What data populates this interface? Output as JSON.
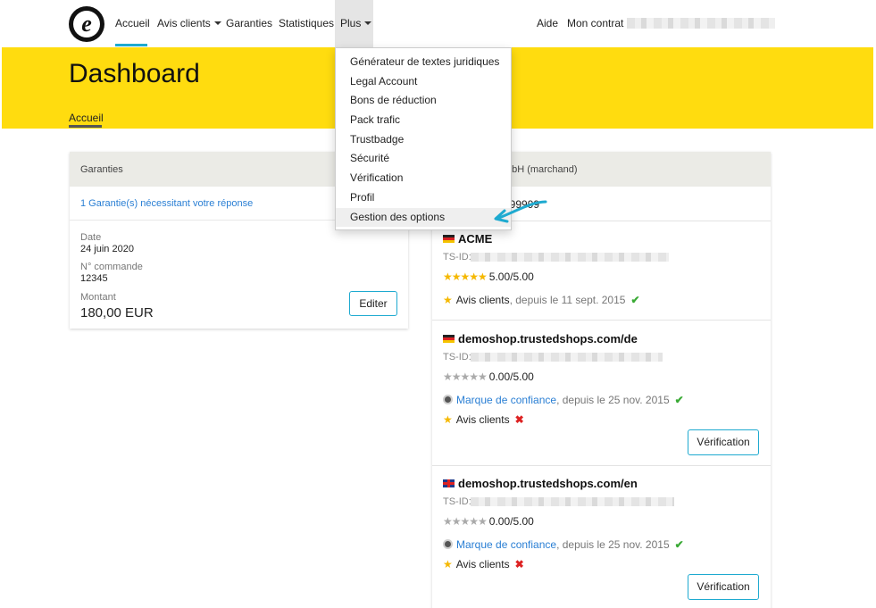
{
  "nav": {
    "logo_letter": "e",
    "items": [
      "Accueil",
      "Avis clients",
      "Garanties",
      "Statistiques",
      "Plus"
    ],
    "aide": "Aide",
    "mon_contrat": "Mon contrat"
  },
  "banner": {
    "title": "Dashboard",
    "breadcrumb": "Accueil"
  },
  "plus_menu": {
    "items": [
      "Générateur de textes juridiques",
      "Legal Account",
      "Bons de réduction",
      "Pack trafic",
      "Trustbadge",
      "Sécurité",
      "Vérification",
      "Profil",
      "Gestion des options"
    ],
    "highlighted_index": 8
  },
  "guarantees_card": {
    "header": "Garanties",
    "link": "1 Garantie(s) nécessitant votre réponse",
    "date_label": "Date",
    "date_value": "24 juin 2020",
    "order_label": "N° commande",
    "order_value": "12345",
    "amount_label": "Montant",
    "amount_value": "180,00 EUR",
    "edit_button": "Editer"
  },
  "merchant_card": {
    "header_partial": "nbH (marchand)",
    "id_partial": "999999",
    "shops": [
      {
        "flag": "de",
        "name": "ACME",
        "tsid_label": "TS-ID:",
        "rating": "5.00/5.00",
        "stars_filled": 5,
        "features": [
          {
            "icon": "star-icon",
            "label": "Avis clients",
            "suffix": ", depuis le 11 sept. 2015",
            "status": "active"
          }
        ]
      },
      {
        "flag": "de",
        "name": "demoshop.trustedshops.com/de",
        "tsid_label": "TS-ID:",
        "rating": "0.00/5.00",
        "stars_filled": 0,
        "features": [
          {
            "icon": "seal-icon",
            "label": "Marque de confiance",
            "suffix": ", depuis le 25 nov. 2015",
            "status": "active"
          },
          {
            "icon": "star-icon",
            "label": "Avis clients",
            "suffix": "",
            "status": "inactive"
          }
        ],
        "button": "Vérification"
      },
      {
        "flag": "uk",
        "name": "demoshop.trustedshops.com/en",
        "tsid_label": "TS-ID:",
        "rating": "0.00/5.00",
        "stars_filled": 0,
        "features": [
          {
            "icon": "seal-icon",
            "label": "Marque de confiance",
            "suffix": ", depuis le 25 nov. 2015",
            "status": "active"
          },
          {
            "icon": "star-icon",
            "label": "Avis clients",
            "suffix": "",
            "status": "inactive"
          }
        ],
        "button": "Vérification"
      }
    ],
    "check_glyph": "✔",
    "cross_glyph": "✖",
    "star_glyph": "★"
  },
  "colors": {
    "brand_yellow": "#ffdc0f",
    "accent_teal": "#1eaad0",
    "link_blue": "#2a7fd4",
    "check_green": "#3aaa35",
    "cross_red": "#dd2222"
  }
}
